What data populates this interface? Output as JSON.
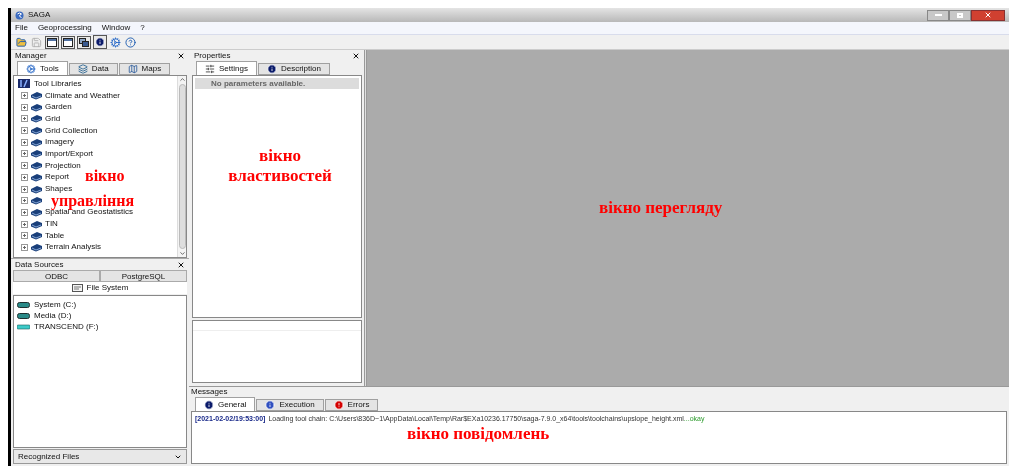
{
  "window": {
    "title": "SAGA"
  },
  "menu": [
    "File",
    "Geoprocessing",
    "Window",
    "?"
  ],
  "toolbar": [
    {
      "kind": "open",
      "disabled": false
    },
    {
      "kind": "save",
      "disabled": true
    },
    {
      "kind": "window",
      "disabled": false
    },
    {
      "kind": "window",
      "disabled": false
    },
    {
      "kind": "windows",
      "disabled": false
    },
    {
      "kind": "info",
      "disabled": false
    },
    {
      "kind": "tools",
      "disabled": false
    },
    {
      "kind": "help",
      "disabled": false
    }
  ],
  "manager": {
    "title": "Manager",
    "tabs": [
      {
        "label": "Tools",
        "kind": "tools",
        "selected": true
      },
      {
        "label": "Data",
        "kind": "data",
        "selected": false
      },
      {
        "label": "Maps",
        "kind": "maps",
        "selected": false
      }
    ],
    "tree": {
      "label": "Tool Libraries",
      "children": [
        {
          "label": "Climate and Weather",
          "expanded": false
        },
        {
          "label": "Garden",
          "expanded": false
        },
        {
          "label": "Grid",
          "expanded": false
        },
        {
          "label": "Grid Collection",
          "expanded": false
        },
        {
          "label": "Imagery",
          "expanded": false
        },
        {
          "label": "Import/Export",
          "expanded": false
        },
        {
          "label": "Projection",
          "expanded": false
        },
        {
          "label": "Report",
          "expanded": false
        },
        {
          "label": "Shapes",
          "expanded": false
        },
        {
          "expanded": false
        },
        {
          "label": "Spatial and Geostatistics",
          "expanded": false
        },
        {
          "label": "TIN",
          "expanded": false
        },
        {
          "label": "Table",
          "expanded": false
        },
        {
          "label": "Terrain Analysis",
          "expanded": false
        }
      ]
    },
    "annotation": [
      "вікно",
      "управління"
    ]
  },
  "data_sources": {
    "title": "Data Sources",
    "tabs": [
      {
        "label": "ODBC",
        "selected": false
      },
      {
        "label": "PostgreSQL",
        "selected": false
      },
      {
        "label": "File System",
        "selected": true
      }
    ],
    "drives": [
      {
        "label": "System (C:)",
        "kind": "fixed"
      },
      {
        "label": "Media (D:)",
        "kind": "fixed"
      },
      {
        "label": "TRANSCEND (F:)",
        "kind": "removable"
      }
    ],
    "filter": "Recognized Files"
  },
  "properties": {
    "title": "Properties",
    "tabs": [
      {
        "label": "Settings",
        "kind": "settings",
        "selected": true
      },
      {
        "label": "Description",
        "kind": "info",
        "selected": false
      }
    ],
    "notice": "No parameters available.",
    "annotation": "вікно властивостей"
  },
  "view": {
    "annotation": "вікно перегляду"
  },
  "messages": {
    "title": "Messages",
    "tabs": [
      {
        "label": "General",
        "kind": "info",
        "selected": true
      },
      {
        "label": "Execution",
        "kind": "exec",
        "selected": false
      },
      {
        "label": "Errors",
        "kind": "error",
        "selected": false
      }
    ],
    "log": [
      {
        "kind": "timestamp",
        "text": "[2021-02-02/19:53:00]"
      },
      {
        "kind": "text",
        "text": "Loading tool chain: C:\\Users\\836D~1\\AppData\\Local\\Temp\\Rar$EXa10236.17750\\saga-7.9.0_x64\\tools\\toolchains\\upslope_height.xml"
      },
      {
        "kind": "status",
        "text": "...okay"
      }
    ],
    "annotation": "вікно повідомлень"
  }
}
